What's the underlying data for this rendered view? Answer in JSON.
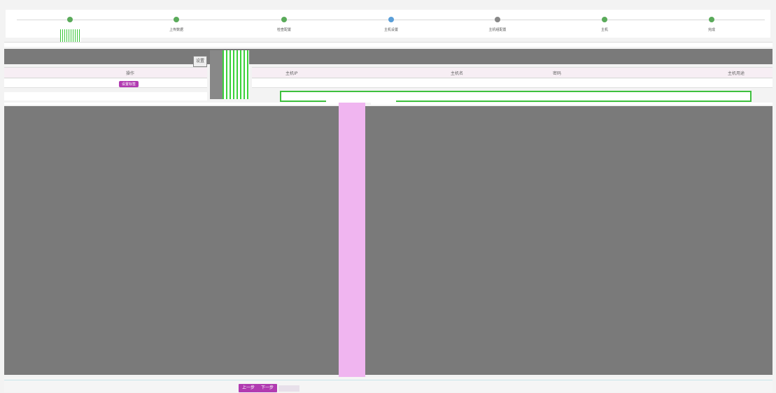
{
  "stepper": {
    "steps": [
      {
        "label": "",
        "color": "#5aaa5a"
      },
      {
        "label": "上传数据",
        "color": "#5aaa5a"
      },
      {
        "label": "检查配置",
        "color": "#5aaa5a"
      },
      {
        "label": "主机设置",
        "color": "#5a9ed8"
      },
      {
        "label": "主机组配置",
        "color": "#888888"
      },
      {
        "label": "主机",
        "color": "#5aaa5a"
      },
      {
        "label": "完成",
        "color": "#5aaa5a"
      }
    ]
  },
  "table": {
    "left_header": "操作",
    "right_headers": [
      "主机IP",
      "主机名",
      "密码",
      "主机用途"
    ],
    "set_tag_label": "设置标签",
    "row1": {
      "ip": "",
      "host": "",
      "pwd": "",
      "use": ""
    },
    "row2": {
      "ip": "",
      "host": "",
      "pwd": "",
      "use": ""
    }
  },
  "sidebar": {
    "icon_label": "设置"
  },
  "footer": {
    "prev": "上一步",
    "next": "下一步"
  },
  "colors": {
    "accent": "#b13bb1",
    "green": "#3ad23a",
    "panel_grey": "#7a7a7a",
    "divider_pink": "#f0b5f0"
  }
}
